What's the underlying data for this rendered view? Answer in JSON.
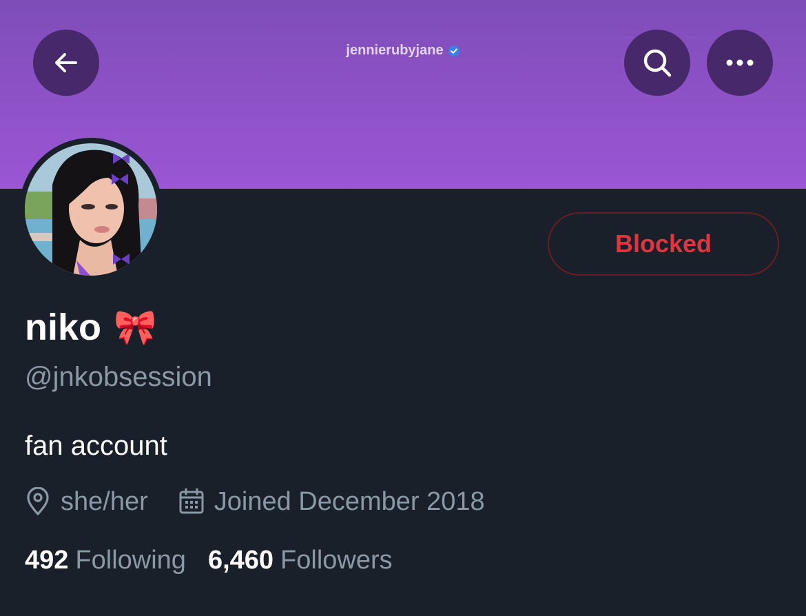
{
  "header": {
    "title": "jennierubyjane",
    "verified": true,
    "back_icon": "arrow-left-icon",
    "search_icon": "search-icon",
    "more_icon": "more-horizontal-icon"
  },
  "profile": {
    "display_name": "niko",
    "name_emoji": "🎀",
    "handle": "@jnkobsession",
    "bio": "fan account",
    "location": "she/her",
    "joined": "Joined December 2018",
    "action_button": "Blocked"
  },
  "stats": {
    "following_count": "492",
    "following_label": "Following",
    "followers_count": "6,460",
    "followers_label": "Followers"
  },
  "colors": {
    "banner": "#8f52c8",
    "background": "#19202a",
    "blocked_text": "#e0353f",
    "secondary_text": "#8b98a5",
    "verified": "#1d9bf0"
  }
}
